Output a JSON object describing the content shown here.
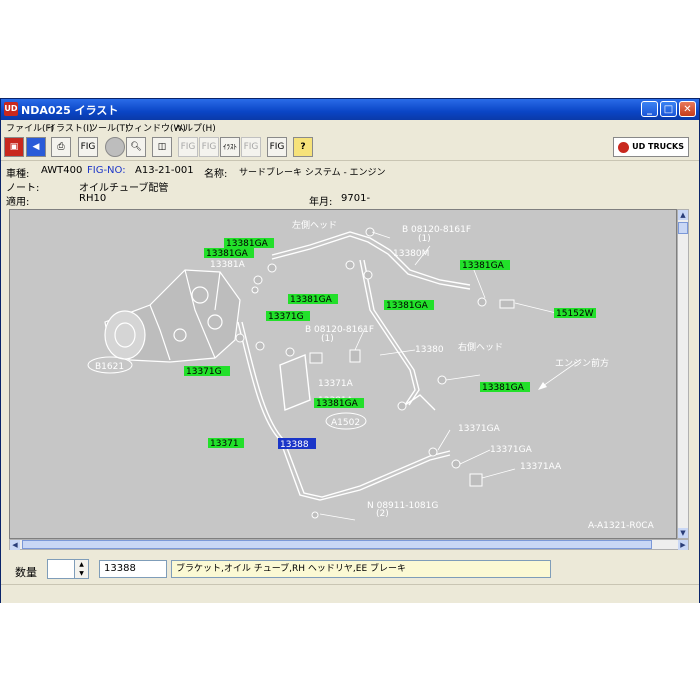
{
  "window": {
    "title": "NDA025 イラスト",
    "app_icon": "app-logo-icon",
    "controls": [
      "minimize",
      "maximize",
      "close"
    ]
  },
  "menu": [
    "ファイル(F)",
    "イラスト(I)",
    "ツール(T)",
    "ウィンドウ(W)",
    "ヘルプ(H)"
  ],
  "toolbar": {
    "fig1": "FIG",
    "fig_next": "FIG",
    "fig_prev": "FIG",
    "illust": "ｲﾗｽﾄ",
    "fig_last": "FIG",
    "fig_q": "FIG",
    "help": "?",
    "brand": "UD TRUCKS"
  },
  "info": {
    "model_label": "車種:",
    "model_value": "AWT400",
    "fig_label": "FIG-NO:",
    "fig_value": "A13-21-001",
    "name_label": "名称:",
    "name_value": "サードブレーキ システム - エンジン",
    "note_label": "ノート:",
    "note_value": "オイルチューブ配管",
    "apply_label": "適用:",
    "apply_value": "RH10",
    "year_label": "年月:",
    "year_value": "9701-"
  },
  "illustration": {
    "green_labels": [
      "13381GA",
      "13381GA",
      "13381A",
      "13381GA",
      "13381GA",
      "13381GA",
      "15152W",
      "13371G",
      "13371G",
      "13381GA",
      "13381GA",
      "13371"
    ],
    "selected_label": "13388",
    "callouts": {
      "left_head": "左側ヘッド",
      "bolt_top": "B 08120-8161F",
      "bolt_top_qty": "(1)",
      "part_13380M": "13380M",
      "bolt_mid": "B 08120-8161F",
      "bolt_mid_qty": "(1)",
      "part_13380": "13380",
      "right_head": "右側ヘッド",
      "engine_front": "エンジン前方",
      "part_b1621": "B1621",
      "part_13371A": "13371A",
      "part_13381A": "13381A",
      "part_a1502": "A1502",
      "part_13371GA": "13371GA",
      "part_13371GA_2": "13371GA",
      "part_13371AA": "13371AA",
      "nut": "N 08911-1081G",
      "nut_qty": "(2)",
      "fig_code": "A-A1321-R0CA"
    }
  },
  "bottom": {
    "qty_label": "数量",
    "qty_value": "",
    "part_no": "13388",
    "description": "ブラケット,オイル チューブ,RH ヘッドリヤ,EE ブレーキ"
  }
}
